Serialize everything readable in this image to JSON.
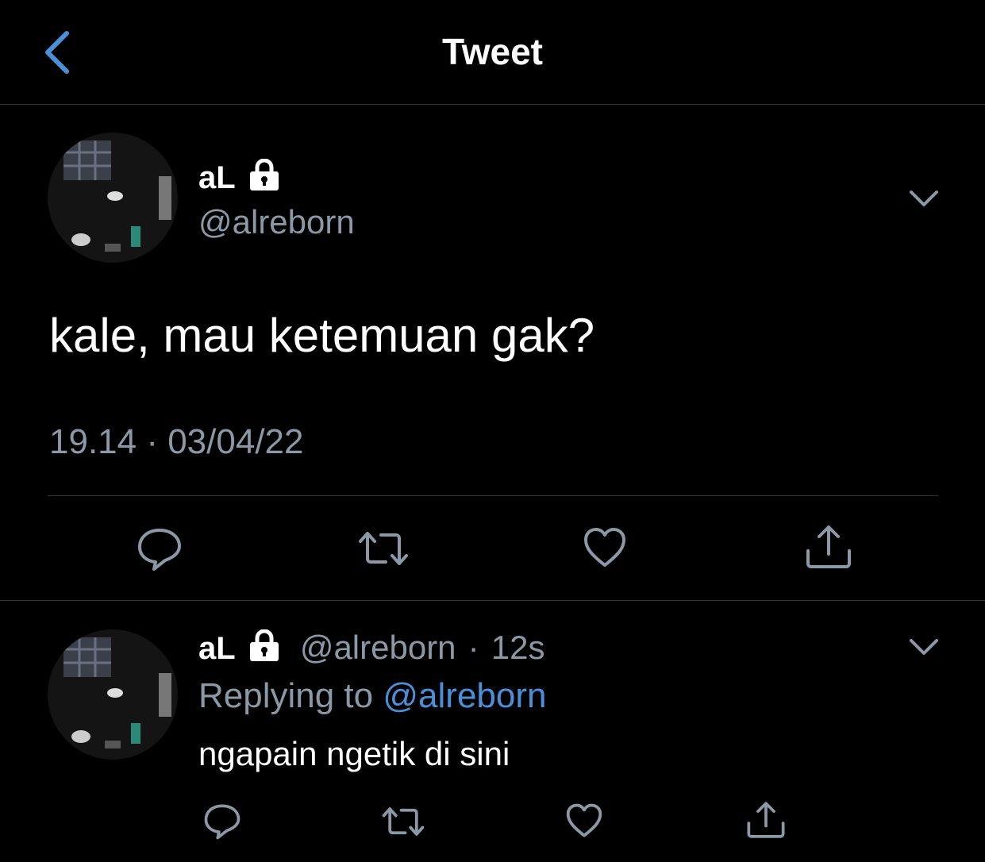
{
  "header": {
    "title": "Tweet"
  },
  "tweet": {
    "author_name": "aL",
    "handle": "@alreborn",
    "text": "kale, mau ketemuan gak?",
    "timestamp": "19.14 · 03/04/22",
    "icons": [
      "back-chevron-icon",
      "lock-icon",
      "chevron-down-icon",
      "reply-icon",
      "retweet-icon",
      "like-icon",
      "share-icon"
    ]
  },
  "reply": {
    "author_name": "aL",
    "handle": "@alreborn",
    "dot": "·",
    "time": "12s",
    "replying_prefix": "Replying to",
    "replying_to": "@alreborn",
    "text": "ngapain ngetik di sini"
  },
  "colors": {
    "background": "#000000",
    "muted": "#8b98a5",
    "accent": "#4a90d9",
    "divider": "#2f3336"
  }
}
